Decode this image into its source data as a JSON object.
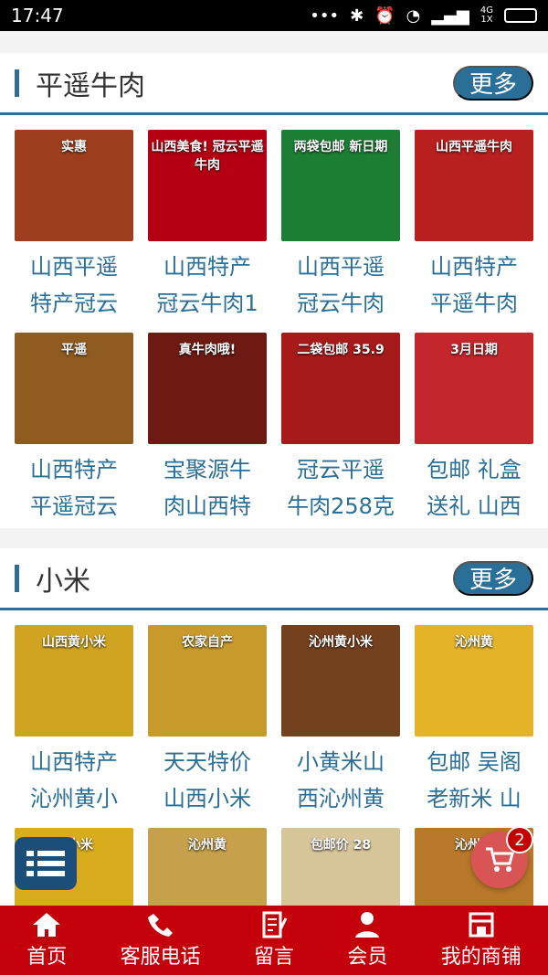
{
  "status": {
    "time": "17:47",
    "network_top": "4G",
    "network_bottom": "1X"
  },
  "sections": [
    {
      "title": "平遥牛肉",
      "more": "更多",
      "products": [
        {
          "line1": "山西平遥",
          "line2": "特产冠云",
          "thumb_text": "实惠",
          "color": "#9d3f1f"
        },
        {
          "line1": "山西特产",
          "line2": "冠云牛肉1",
          "thumb_text": "山西美食! 冠云平遥牛肉",
          "color": "#b40012"
        },
        {
          "line1": "山西平遥",
          "line2": "冠云牛肉",
          "thumb_text": "两袋包邮 新日期",
          "color": "#1d7d35"
        },
        {
          "line1": "山西特产",
          "line2": "平遥牛肉",
          "thumb_text": "山西平遥牛肉",
          "color": "#b81f1f"
        },
        {
          "line1": "山西特产",
          "line2": "平遥冠云",
          "thumb_text": "平遥",
          "color": "#8f5b1e"
        },
        {
          "line1": "宝聚源牛",
          "line2": "肉山西特",
          "thumb_text": "真牛肉哦!",
          "color": "#6c1a12"
        },
        {
          "line1": "冠云平遥",
          "line2": "牛肉258克",
          "thumb_text": "二袋包邮 35.9",
          "color": "#a61a1a"
        },
        {
          "line1": "包邮 礼盒",
          "line2": "送礼 山西",
          "thumb_text": "3月日期",
          "color": "#c3262b"
        }
      ]
    },
    {
      "title": "小米",
      "more": "更多",
      "products": [
        {
          "line1": "山西特产",
          "line2": "沁州黄小",
          "thumb_text": "山西黄小米",
          "color": "#d0a421"
        },
        {
          "line1": "天天特价",
          "line2": "山西小米",
          "thumb_text": "农家自产",
          "color": "#c79a2b"
        },
        {
          "line1": "小黄米山",
          "line2": "西沁州黄",
          "thumb_text": "沁州黄小米",
          "color": "#74411f"
        },
        {
          "line1": "包邮 吴阁",
          "line2": "老新米 山",
          "thumb_text": "沁州黄",
          "color": "#e5b328"
        },
        {
          "line1": "",
          "line2": "",
          "thumb_text": "黄小米",
          "color": "#d9ac1e"
        },
        {
          "line1": "",
          "line2": "",
          "thumb_text": "沁州黄",
          "color": "#c6a04a"
        },
        {
          "line1": "",
          "line2": "",
          "thumb_text": "包邮价 28",
          "color": "#d7c59a"
        },
        {
          "line1": "",
          "line2": "",
          "thumb_text": "沁州黄",
          "color": "#b8782a"
        }
      ]
    }
  ],
  "cart": {
    "count": "2"
  },
  "nav": [
    {
      "label": "首页",
      "icon": "home-icon"
    },
    {
      "label": "客服电话",
      "icon": "phone-icon"
    },
    {
      "label": "留言",
      "icon": "message-icon"
    },
    {
      "label": "会员",
      "icon": "user-icon"
    },
    {
      "label": "我的商铺",
      "icon": "shop-icon"
    }
  ]
}
